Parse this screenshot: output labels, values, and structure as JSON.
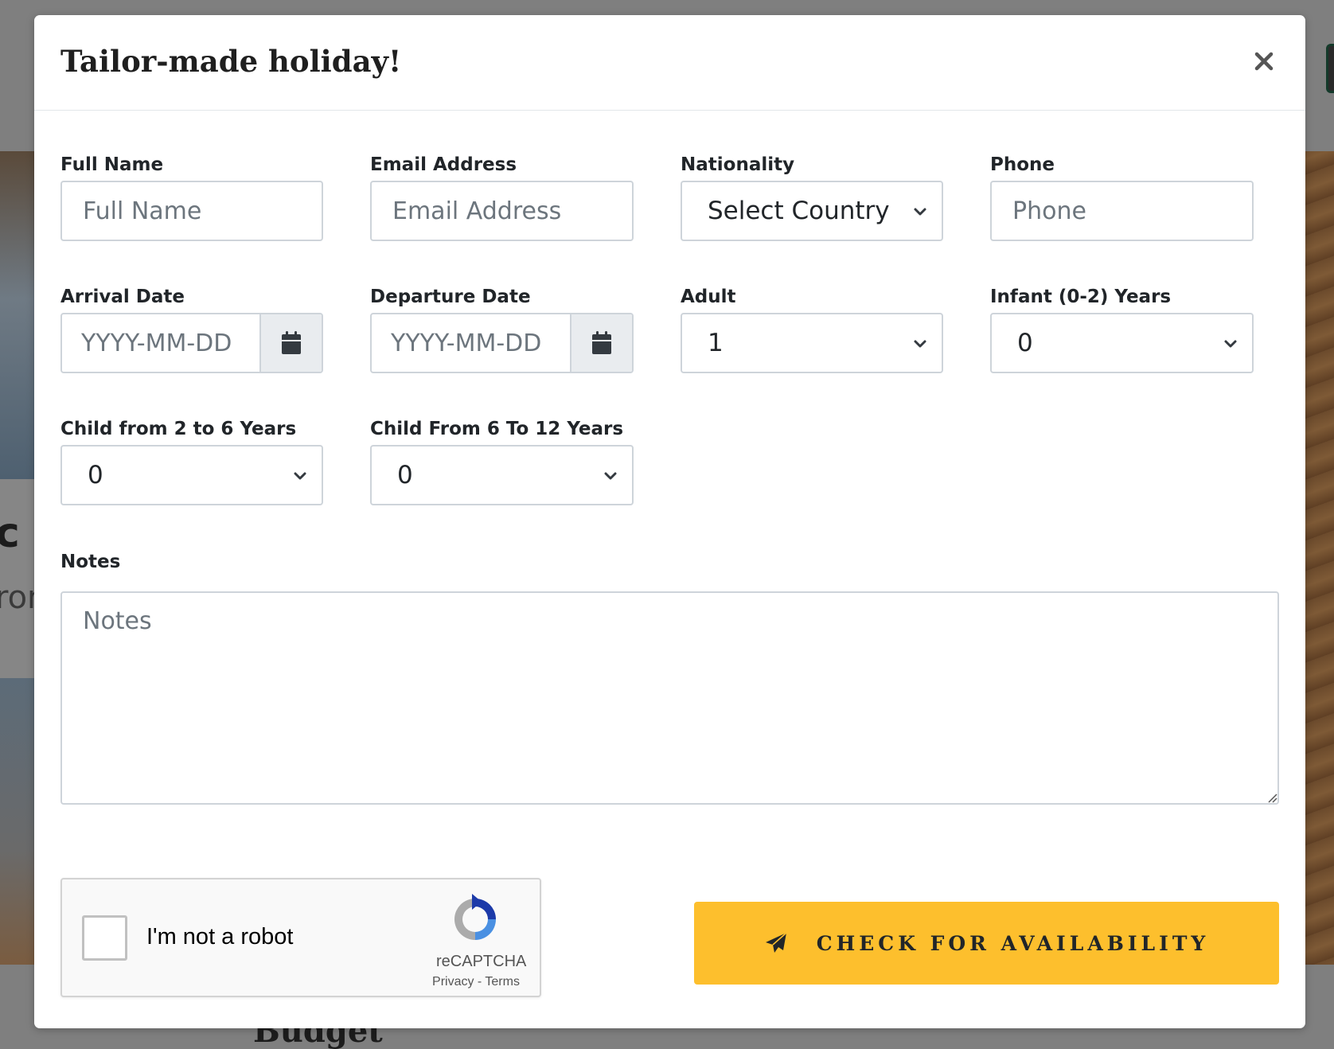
{
  "background": {
    "fragment_c": "c",
    "fragment_on": "ron",
    "fragment_budget": "Budget"
  },
  "modal": {
    "title": "Tailor-made holiday!",
    "close_icon": "close-icon"
  },
  "form": {
    "full_name": {
      "label": "Full Name",
      "placeholder": "Full Name"
    },
    "email": {
      "label": "Email Address",
      "placeholder": "Email Address"
    },
    "nationality": {
      "label": "Nationality",
      "selected": "Select Country"
    },
    "phone": {
      "label": "Phone",
      "placeholder": "Phone"
    },
    "arrival": {
      "label": "Arrival Date",
      "placeholder": "YYYY-MM-DD",
      "icon": "calendar-icon"
    },
    "departure": {
      "label": "Departure Date",
      "placeholder": "YYYY-MM-DD",
      "icon": "calendar-icon"
    },
    "adult": {
      "label": "Adult",
      "selected": "1"
    },
    "infant": {
      "label": "Infant (0-2) Years",
      "selected": "0"
    },
    "child_2_6": {
      "label": "Child from 2 to 6 Years",
      "selected": "0"
    },
    "child_6_12": {
      "label": "Child From 6 To 12 Years",
      "selected": "0"
    },
    "notes": {
      "label": "Notes",
      "placeholder": "Notes"
    }
  },
  "recaptcha": {
    "text": "I'm not a robot",
    "brand": "reCAPTCHA",
    "privacy": "Privacy",
    "separator": " - ",
    "terms": "Terms"
  },
  "submit": {
    "label": "CHECK FOR AVAILABILITY",
    "icon": "paper-plane-icon",
    "color": "#fdbf2d"
  }
}
